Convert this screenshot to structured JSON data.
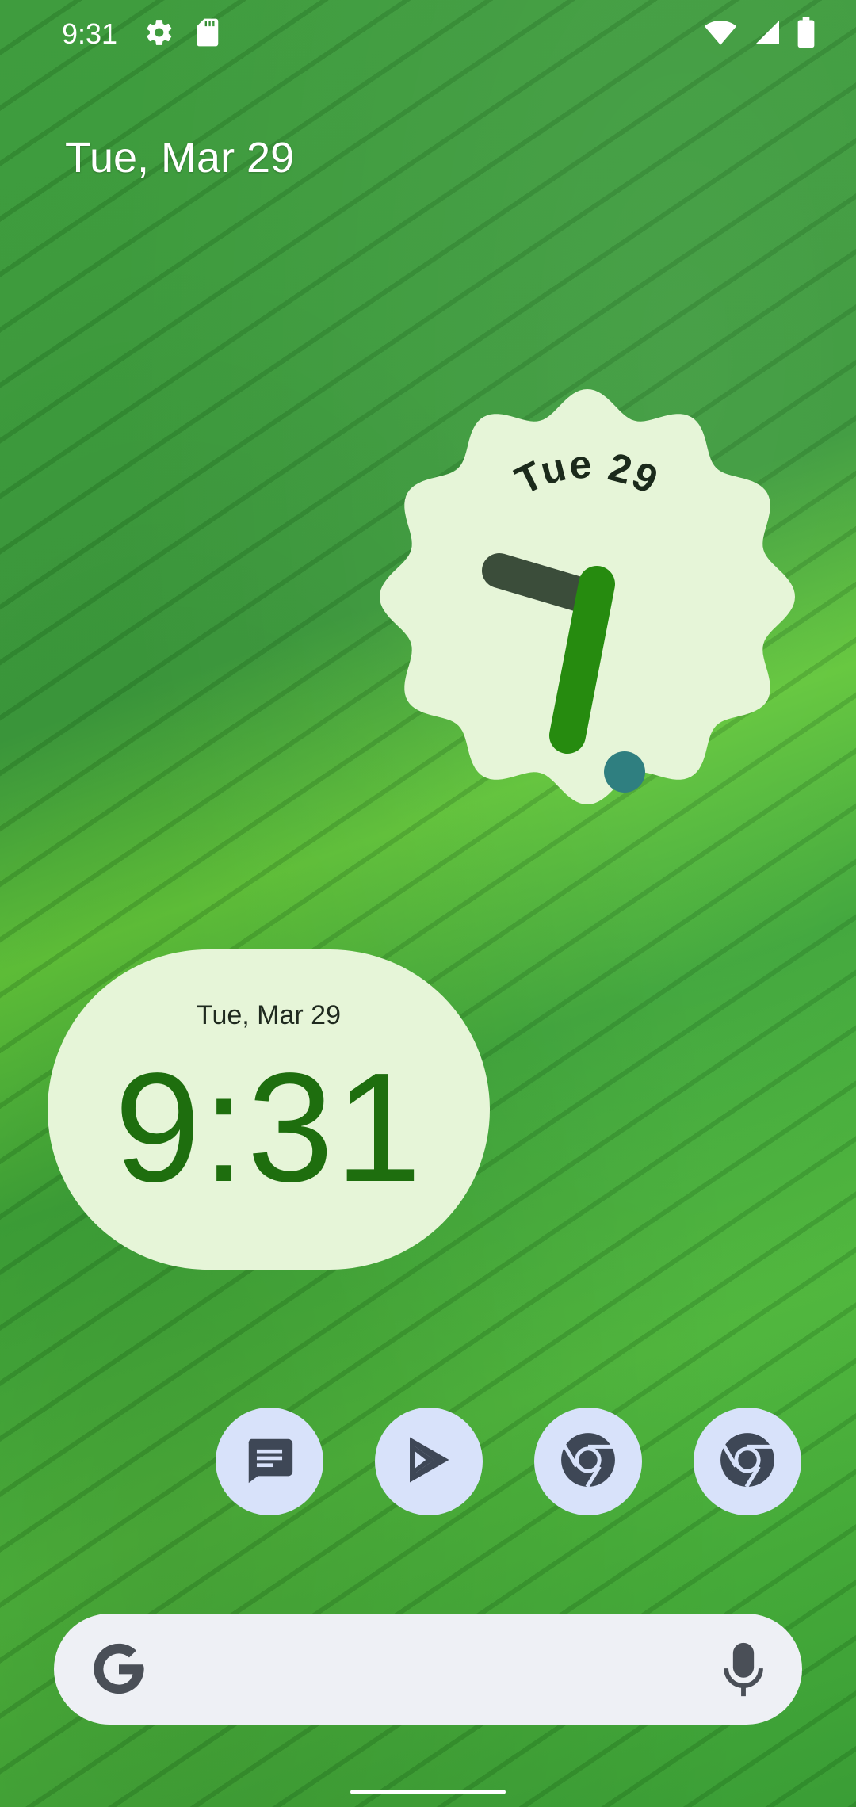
{
  "status_bar": {
    "time": "9:31",
    "left_icons": [
      "gear-icon",
      "sd-card-icon"
    ],
    "right_icons": [
      "wifi-icon",
      "signal-icon",
      "battery-icon"
    ]
  },
  "home": {
    "date": "Tue, Mar 29"
  },
  "analog_clock_widget": {
    "date_label": "Tue 29",
    "hour": 9,
    "minute": 31
  },
  "digital_clock_widget": {
    "date": "Tue, Mar 29",
    "time": "9:31"
  },
  "dock": {
    "apps": [
      {
        "name": "Messages",
        "icon": "messages-icon"
      },
      {
        "name": "Play Store",
        "icon": "play-store-icon"
      },
      {
        "name": "Chrome",
        "icon": "chrome-icon"
      },
      {
        "name": "Chrome",
        "icon": "chrome-icon"
      }
    ]
  },
  "search_bar": {
    "left_icon": "google-g-icon",
    "right_icon": "microphone-icon"
  },
  "colors": {
    "widget_bg": "#e6f5d8",
    "clock_green": "#1e6e0e",
    "dock_icon_bg": "#d8e2fa"
  }
}
